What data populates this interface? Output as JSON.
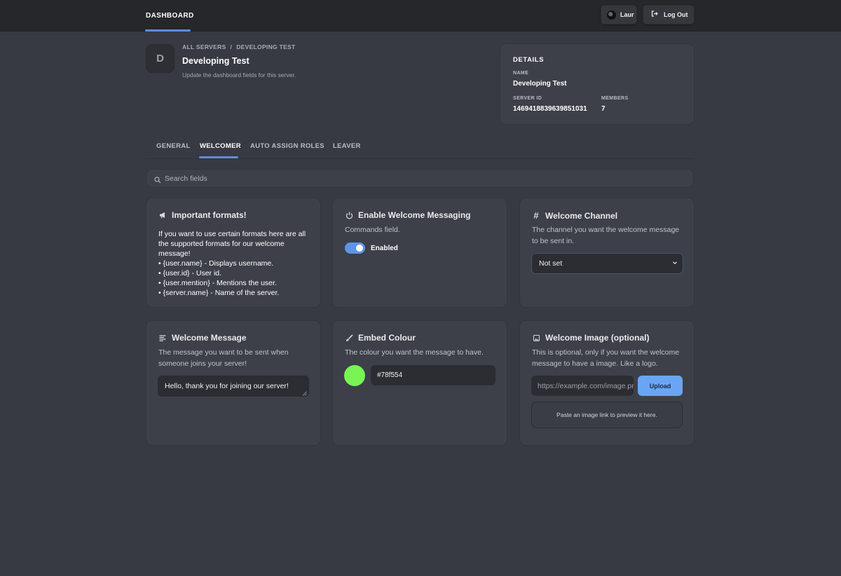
{
  "topbar": {
    "nav_label": "DASHBOARD",
    "user_label": "Laur",
    "logout_label": "Log Out"
  },
  "server": {
    "initial": "D",
    "breadcrumb": [
      "ALL SERVERS",
      "DEVELOPING TEST"
    ],
    "breadcrumb_separator": "/",
    "title": "Developing Test",
    "subtitle": "Update the dashboard fields for this server."
  },
  "details": {
    "title": "DETAILS",
    "name_label": "NAME",
    "name_value": "Developing Test",
    "server_id_label": "SERVER ID",
    "server_id_value": "1469418839639851031",
    "members_label": "MEMBERS",
    "members_value": "7"
  },
  "tabs": [
    "GENERAL",
    "WELCOMER",
    "AUTO ASSIGN ROLES",
    "LEAVER"
  ],
  "active_tab": "WELCOMER",
  "search": {
    "placeholder": "Search fields"
  },
  "cards": {
    "formats": {
      "icon": "megaphone-icon",
      "title": "Important formats!",
      "lines": [
        "If you want to use certain formats here are all",
        "the supported formats for our welcome",
        "message!",
        "• {user.name} - Displays username.",
        "• {user.id} - User id.",
        "• {user.mention} - Mentions the user.",
        "• {server.name} - Name of the server."
      ]
    },
    "enable": {
      "icon": "power-icon",
      "title": "Enable Welcome Messaging",
      "description": "Commands field.",
      "toggle_state": "on",
      "toggle_label": "Enabled"
    },
    "channel": {
      "icon": "hash-icon",
      "title": "Welcome Channel",
      "description": "The channel you want the welcome message to be sent in.",
      "selected": "Not set"
    },
    "message": {
      "icon": "text-lines-icon",
      "title": "Welcome Message",
      "description": "The message you want to be sent when someone joins your server!",
      "value": "Hello, thank you for joining our server!"
    },
    "colour": {
      "icon": "brush-icon",
      "title": "Embed Colour",
      "description": "The colour you want the message to have.",
      "value": "#78f554",
      "swatch": "#78f554"
    },
    "image": {
      "icon": "image-icon",
      "title": "Welcome Image (optional)",
      "description": "This is optional, only if you want the welcome message to have a image. Like a logo.",
      "url_placeholder": "https://example.com/image.png",
      "upload_label": "Upload",
      "preview_text": "Paste an image link to preview it here."
    }
  },
  "colors": {
    "background": "#373a43",
    "topbar": "#26272b",
    "card": "#3d4049",
    "accent": "#5b8fd9",
    "upload_button": "#6aa5f4"
  }
}
